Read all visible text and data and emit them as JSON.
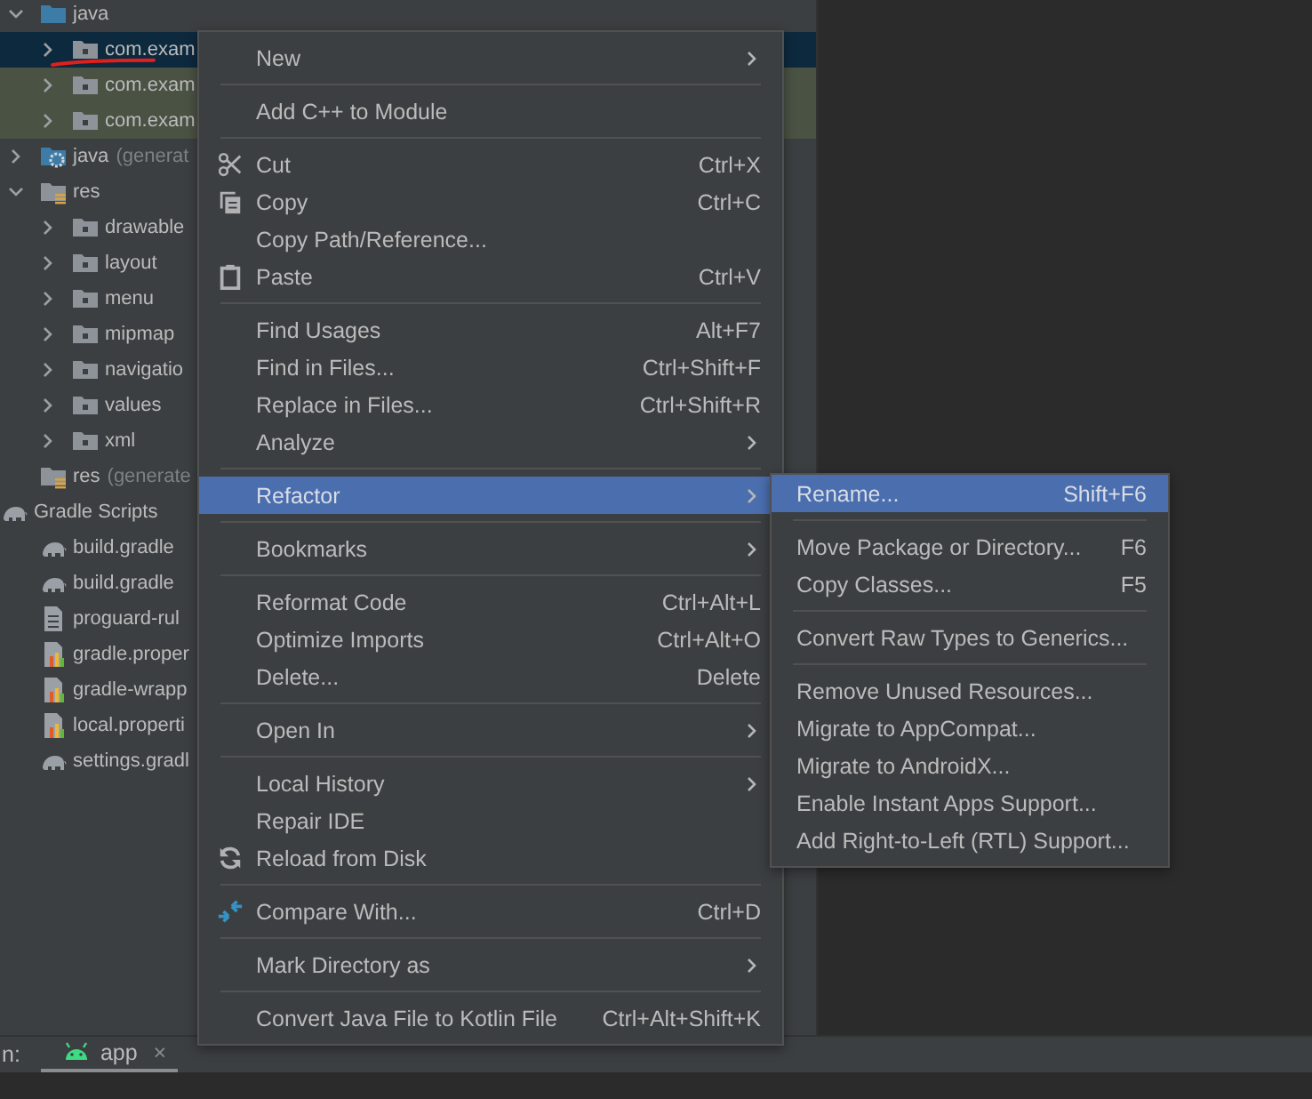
{
  "tree": [
    {
      "label": "java",
      "kind": "source-folder",
      "expanded": true,
      "selected": false,
      "highlighted": false,
      "children": [
        {
          "label": "com.exam",
          "kind": "package",
          "expanded": false,
          "selected": true,
          "highlighted": false
        },
        {
          "label": "com.exam",
          "kind": "package",
          "expanded": false,
          "selected": false,
          "highlighted": true
        },
        {
          "label": "com.exam",
          "kind": "package",
          "expanded": false,
          "selected": false,
          "highlighted": true
        }
      ]
    },
    {
      "label": "java",
      "note": "(generat",
      "kind": "generated-folder",
      "expanded": false,
      "selected": false,
      "highlighted": false
    },
    {
      "label": "res",
      "kind": "resource-folder",
      "expanded": true,
      "selected": false,
      "highlighted": false,
      "children": [
        {
          "label": "drawable",
          "kind": "package",
          "expanded": false,
          "selected": false,
          "highlighted": false
        },
        {
          "label": "layout",
          "kind": "package",
          "expanded": false,
          "selected": false,
          "highlighted": false
        },
        {
          "label": "menu",
          "kind": "package",
          "expanded": false,
          "selected": false,
          "highlighted": false
        },
        {
          "label": "mipmap",
          "kind": "package",
          "expanded": false,
          "selected": false,
          "highlighted": false
        },
        {
          "label": "navigatio",
          "kind": "package",
          "expanded": false,
          "selected": false,
          "highlighted": false
        },
        {
          "label": "values",
          "kind": "package",
          "expanded": false,
          "selected": false,
          "highlighted": false
        },
        {
          "label": "xml",
          "kind": "package",
          "expanded": false,
          "selected": false,
          "highlighted": false
        }
      ]
    },
    {
      "label": "res",
      "note": "(generate",
      "kind": "generated-resource-folder",
      "selected": false,
      "highlighted": false
    },
    {
      "label": "Gradle Scripts",
      "kind": "gradle-root",
      "selected": false,
      "highlighted": false,
      "children": [
        {
          "label": "build.gradle",
          "kind": "gradle",
          "selected": false,
          "highlighted": false
        },
        {
          "label": "build.gradle",
          "kind": "gradle",
          "selected": false,
          "highlighted": false
        },
        {
          "label": "proguard-rul",
          "kind": "text-file",
          "selected": false,
          "highlighted": false
        },
        {
          "label": "gradle.proper",
          "kind": "properties-file",
          "selected": false,
          "highlighted": false
        },
        {
          "label": "gradle-wrapp",
          "kind": "properties-file",
          "selected": false,
          "highlighted": false
        },
        {
          "label": "local.properti",
          "kind": "properties-file",
          "selected": false,
          "highlighted": false
        },
        {
          "label": "settings.gradl",
          "kind": "gradle",
          "selected": false,
          "highlighted": false
        }
      ]
    }
  ],
  "context_menu": [
    {
      "kind": "item",
      "label": "New",
      "submenu": true,
      "selected": false
    },
    {
      "kind": "separator"
    },
    {
      "kind": "item",
      "label": "Add C++ to Module",
      "submenu": false,
      "selected": false
    },
    {
      "kind": "separator"
    },
    {
      "kind": "scissors",
      "label": "Cut",
      "shortcut": "Ctrl+X",
      "submenu": false,
      "selected": false
    },
    {
      "kind": "copy",
      "label": "Copy",
      "shortcut": "Ctrl+C",
      "submenu": false,
      "selected": false
    },
    {
      "kind": "item",
      "label": "Copy Path/Reference...",
      "submenu": false,
      "selected": false
    },
    {
      "kind": "clipboard",
      "label": "Paste",
      "shortcut": "Ctrl+V",
      "submenu": false,
      "selected": false
    },
    {
      "kind": "separator"
    },
    {
      "kind": "item",
      "label": "Find Usages",
      "shortcut": "Alt+F7",
      "submenu": false,
      "selected": false
    },
    {
      "kind": "item",
      "label": "Find in Files...",
      "shortcut": "Ctrl+Shift+F",
      "submenu": false,
      "selected": false
    },
    {
      "kind": "item",
      "label": "Replace in Files...",
      "shortcut": "Ctrl+Shift+R",
      "submenu": false,
      "selected": false
    },
    {
      "kind": "item",
      "label": "Analyze",
      "submenu": true,
      "selected": false
    },
    {
      "kind": "separator"
    },
    {
      "kind": "item",
      "label": "Refactor",
      "submenu": true,
      "selected": true
    },
    {
      "kind": "separator"
    },
    {
      "kind": "item",
      "label": "Bookmarks",
      "submenu": true,
      "selected": false
    },
    {
      "kind": "separator"
    },
    {
      "kind": "item",
      "label": "Reformat Code",
      "shortcut": "Ctrl+Alt+L",
      "submenu": false,
      "selected": false
    },
    {
      "kind": "item",
      "label": "Optimize Imports",
      "shortcut": "Ctrl+Alt+O",
      "submenu": false,
      "selected": false
    },
    {
      "kind": "item",
      "label": "Delete...",
      "shortcut": "Delete",
      "submenu": false,
      "selected": false
    },
    {
      "kind": "separator"
    },
    {
      "kind": "item",
      "label": "Open In",
      "submenu": true,
      "selected": false
    },
    {
      "kind": "separator"
    },
    {
      "kind": "item",
      "label": "Local History",
      "submenu": true,
      "selected": false
    },
    {
      "kind": "item",
      "label": "Repair IDE",
      "submenu": false,
      "selected": false
    },
    {
      "kind": "reload",
      "label": "Reload from Disk",
      "submenu": false,
      "selected": false
    },
    {
      "kind": "separator"
    },
    {
      "kind": "compare",
      "label": "Compare With...",
      "shortcut": "Ctrl+D",
      "submenu": false,
      "selected": false
    },
    {
      "kind": "separator"
    },
    {
      "kind": "item",
      "label": "Mark Directory as",
      "submenu": true,
      "selected": false
    },
    {
      "kind": "separator"
    },
    {
      "kind": "item",
      "label": "Convert Java File to Kotlin File",
      "shortcut": "Ctrl+Alt+Shift+K",
      "submenu": false,
      "selected": false
    }
  ],
  "refactor_submenu": [
    {
      "kind": "item",
      "label": "Rename...",
      "shortcut": "Shift+F6",
      "selected": true
    },
    {
      "kind": "separator"
    },
    {
      "kind": "item",
      "label": "Move Package or Directory...",
      "shortcut": "F6",
      "selected": false
    },
    {
      "kind": "item",
      "label": "Copy Classes...",
      "shortcut": "F5",
      "selected": false
    },
    {
      "kind": "separator"
    },
    {
      "kind": "item",
      "label": "Convert Raw Types to Generics...",
      "selected": false
    },
    {
      "kind": "separator"
    },
    {
      "kind": "item",
      "label": "Remove Unused Resources...",
      "selected": false
    },
    {
      "kind": "item",
      "label": "Migrate to AppCompat...",
      "selected": false
    },
    {
      "kind": "item",
      "label": "Migrate to AndroidX...",
      "selected": false
    },
    {
      "kind": "item",
      "label": "Enable Instant Apps Support...",
      "selected": false
    },
    {
      "kind": "item",
      "label": "Add Right-to-Left (RTL) Support...",
      "selected": false
    }
  ],
  "bottom_panel": {
    "label": "n:",
    "tabs": [
      {
        "label": "app",
        "close": "×",
        "selected": true
      }
    ]
  }
}
